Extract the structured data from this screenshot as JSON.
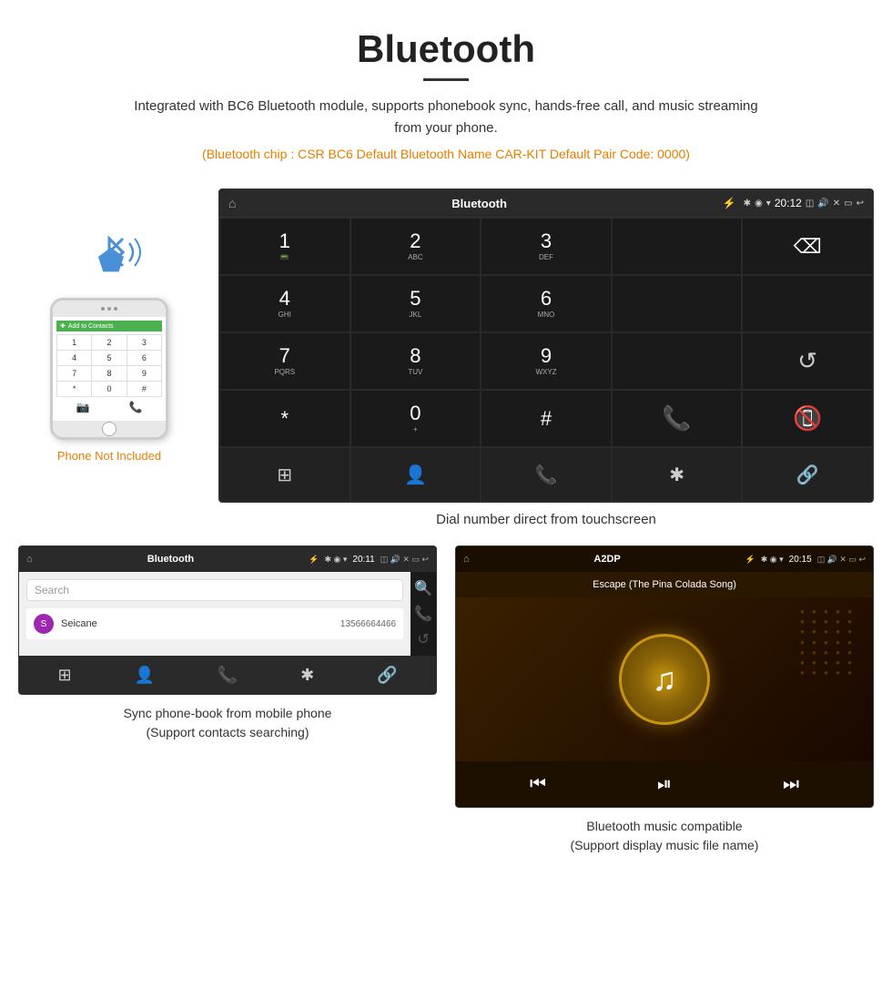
{
  "header": {
    "title": "Bluetooth",
    "description": "Integrated with BC6 Bluetooth module, supports phonebook sync, hands-free call, and music streaming from your phone.",
    "specs": "(Bluetooth chip : CSR BC6    Default Bluetooth Name CAR-KIT    Default Pair Code: 0000)"
  },
  "dial_screen": {
    "status_title": "Bluetooth",
    "time": "20:12",
    "keys": [
      {
        "main": "1",
        "sub": ""
      },
      {
        "main": "2",
        "sub": "ABC"
      },
      {
        "main": "3",
        "sub": "DEF"
      },
      {
        "main": "",
        "sub": "",
        "type": "empty"
      },
      {
        "main": "⌫",
        "sub": "",
        "type": "backspace"
      },
      {
        "main": "4",
        "sub": "GHI"
      },
      {
        "main": "5",
        "sub": "JKL"
      },
      {
        "main": "6",
        "sub": "MNO"
      },
      {
        "main": "",
        "sub": "",
        "type": "empty"
      },
      {
        "main": "",
        "sub": "",
        "type": "empty"
      },
      {
        "main": "7",
        "sub": "PQRS"
      },
      {
        "main": "8",
        "sub": "TUV"
      },
      {
        "main": "9",
        "sub": "WXYZ"
      },
      {
        "main": "",
        "sub": "",
        "type": "empty"
      },
      {
        "main": "↺",
        "sub": "",
        "type": "refresh"
      },
      {
        "main": "*",
        "sub": ""
      },
      {
        "main": "0",
        "sub": "+"
      },
      {
        "main": "#",
        "sub": ""
      },
      {
        "main": "📞",
        "sub": "",
        "type": "call-green"
      },
      {
        "main": "📵",
        "sub": "",
        "type": "call-red"
      }
    ],
    "bottom_icons": [
      "⊞",
      "👤",
      "📞",
      "✱",
      "🔗"
    ]
  },
  "dial_caption": "Dial number direct from touchscreen",
  "phonebook_screen": {
    "status_title": "Bluetooth",
    "time": "20:11",
    "search_placeholder": "Search",
    "contact": {
      "avatar_letter": "S",
      "name": "Seicane",
      "phone": "13566664466"
    }
  },
  "phonebook_caption": "Sync phone-book from mobile phone\n(Support contacts searching)",
  "music_screen": {
    "status_title": "A2DP",
    "time": "20:15",
    "song_title": "Escape (The Pina Colada Song)"
  },
  "music_caption": "Bluetooth music compatible\n(Support display music file name)",
  "phone_not_included": "Phone Not Included"
}
